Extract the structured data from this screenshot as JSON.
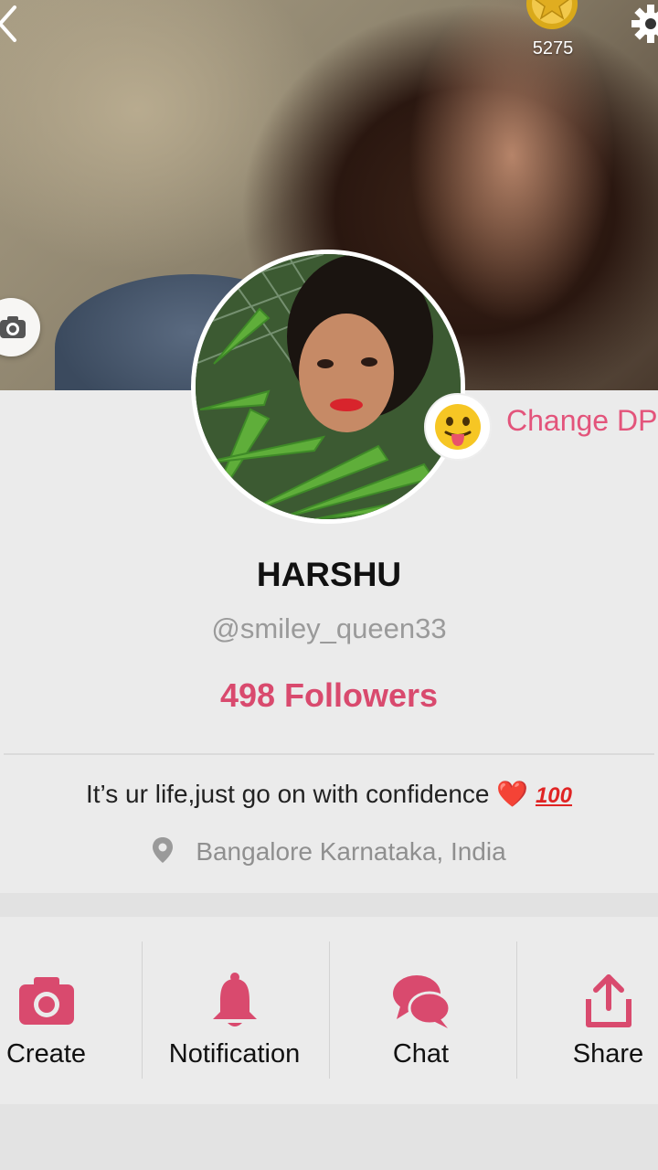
{
  "header": {
    "coin_count": "5275",
    "icons": [
      "back-icon",
      "coin-icon",
      "gear-icon",
      "camera-icon"
    ]
  },
  "profile": {
    "change_dp_label": "Change DP",
    "name": "HARSHU",
    "handle": "@smiley_queen33",
    "followers": "498 Followers",
    "bio_text": "It’s ur life,just go on with confidence",
    "bio_heart": "❤️",
    "bio_hundred": "100",
    "location": "Bangalore Karnataka, India"
  },
  "actions": [
    {
      "label": "Create",
      "icon": "camera-icon"
    },
    {
      "label": "Notification",
      "icon": "bell-icon"
    },
    {
      "label": "Chat",
      "icon": "chat-icon"
    },
    {
      "label": "Share",
      "icon": "share-icon"
    }
  ],
  "colors": {
    "accent": "#d94a6e",
    "background": "#ebebeb"
  }
}
